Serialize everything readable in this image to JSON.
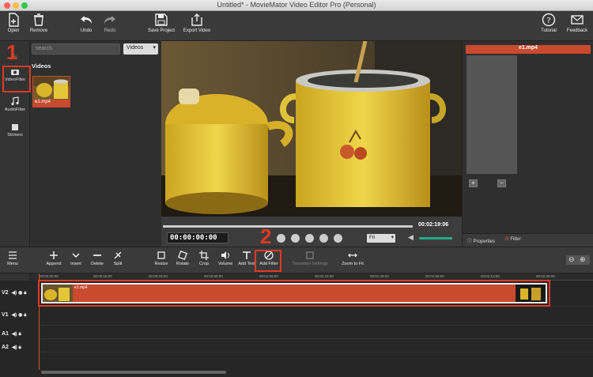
{
  "window": {
    "title": "Untitled* - MovieMator Video Editor Pro (Personal)"
  },
  "toolbar": {
    "open": "Open",
    "remove": "Remove",
    "undo": "Undo",
    "redo": "Redo",
    "save_project": "Save Project",
    "export_video": "Export Video",
    "tutorial": "Tutorial",
    "feedback": "Feedback"
  },
  "rail": {
    "video_filter": "VideoFilter",
    "audio_filter": "AudioFilter",
    "stickers": "Stickers",
    "partial": "Fi"
  },
  "media": {
    "search_placeholder": "search",
    "category": "Videos",
    "heading": "Videos",
    "clip_name": "e1.mp4"
  },
  "preview": {
    "duration": "00:02:19:06",
    "timecode": "00:00:00:00",
    "fit": "Fit"
  },
  "right_panel": {
    "title": "e1.mp4",
    "add": "+",
    "remove": "−",
    "tab_properties": "Properties",
    "tab_filter": "Filter",
    "filter_glyph": "fx"
  },
  "edit_toolbar": {
    "menu": "Menu",
    "append": "Append",
    "insert": "Insert",
    "delete": "Delete",
    "split": "Split",
    "resize": "Resize",
    "rotate": "Rotate",
    "crop": "Crop",
    "volume": "Volume",
    "add_text": "Add Text",
    "add_filter": "Add Filter",
    "transition_settings": "Transition Settings",
    "zoom_to_fit": "Zoom to Fit"
  },
  "timeline": {
    "ticks": [
      "00:00:00:00",
      "00:00:16:00",
      "00:00:33:00",
      "00:00:50:00",
      "00:01:06:00",
      "00:01:23:00",
      "00:01:40:00",
      "00:01:56:00",
      "00:02:13:00",
      "00:02:29:00"
    ],
    "tracks": [
      "V2",
      "V1",
      "A1",
      "A2"
    ],
    "clip_label": "e1.mp4"
  },
  "annotations": {
    "step1": "1",
    "step2": "2"
  },
  "colors": {
    "accent": "#c84a2f",
    "annotation": "#e03a22",
    "volume": "#1fae8a"
  }
}
